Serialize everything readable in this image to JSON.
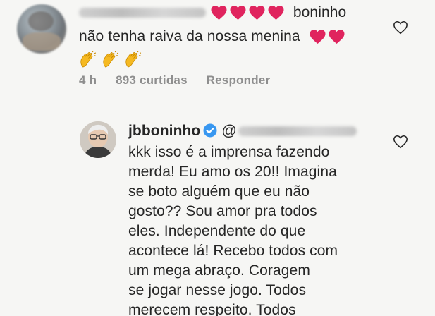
{
  "comments": [
    {
      "username_blurred": "(blurred)",
      "text_line1_suffix": "boninho",
      "text_line2": "não tenha raiva da nossa menina",
      "time": "4 h",
      "likes": "893 curtidas",
      "reply_label": "Responder",
      "heart_icon": "heart-emoji",
      "clap_icon": "clapping-hands-emoji"
    },
    {
      "username": "jbboninho",
      "mention_prefix": "@",
      "verified_icon": "verified-badge-icon",
      "lines": [
        "kkk isso é a imprensa fazendo",
        "merda! Eu amo os 20!! Imagina",
        "se boto alguém que eu não",
        "gosto?? Sou amor pra todos",
        "eles. Independente do que",
        "acontece lá! Recebo todos com",
        "um mega abraço. Coragem",
        "se jogar nesse jogo. Todos",
        "merecem respeito. Todos"
      ]
    }
  ],
  "colors": {
    "background": "#f6f6f4",
    "text": "#262626",
    "meta": "#8e8e8e",
    "heart": "#e0245e",
    "verified": "#3897f0"
  }
}
